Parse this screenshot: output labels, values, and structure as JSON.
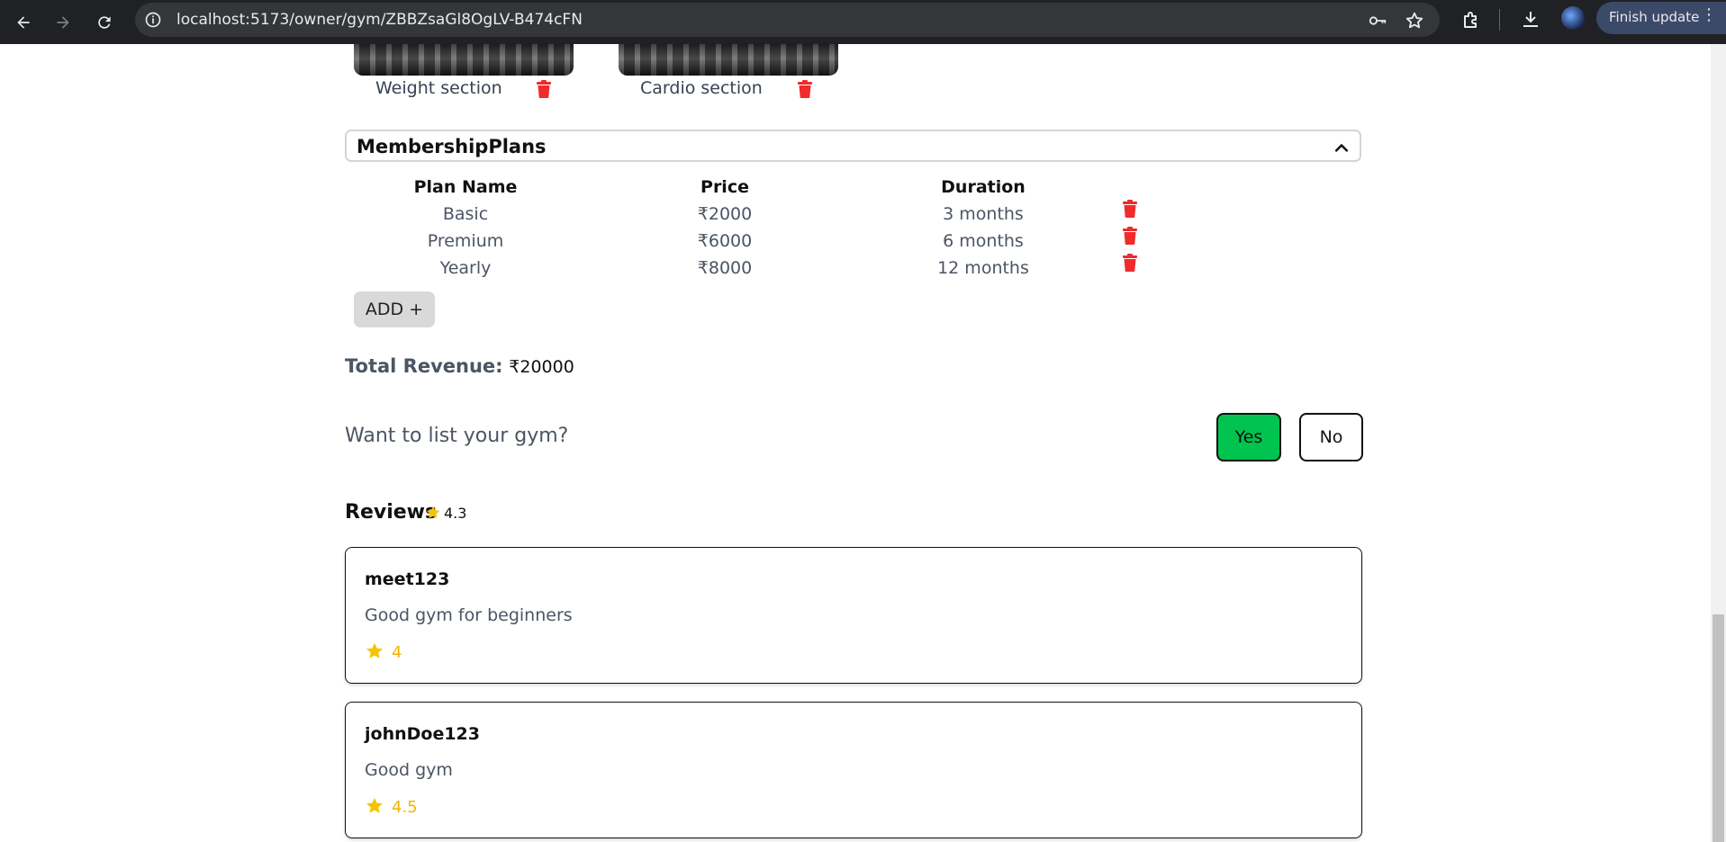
{
  "browser": {
    "url": "localhost:5173/owner/gym/ZBBZsaGl8OgLV-B474cFN",
    "finish_update_label": "Finish update"
  },
  "images": [
    {
      "caption": "Weight section"
    },
    {
      "caption": "Cardio section"
    }
  ],
  "membership": {
    "title": "MembershipPlans",
    "headers": {
      "plan": "Plan Name",
      "price": "Price",
      "duration": "Duration"
    },
    "plans": [
      {
        "name": "Basic",
        "price": "₹2000",
        "duration": "3 months"
      },
      {
        "name": "Premium",
        "price": "₹6000",
        "duration": "6 months"
      },
      {
        "name": "Yearly",
        "price": "₹8000",
        "duration": "12 months"
      }
    ],
    "add_label": "ADD +"
  },
  "revenue": {
    "label": "Total Revenue:",
    "value": "₹20000"
  },
  "listing": {
    "question": "Want to list your gym?",
    "yes_label": "Yes",
    "no_label": "No"
  },
  "reviews": {
    "title": "Reviews",
    "average": "4.3",
    "items": [
      {
        "user": "meet123",
        "text": "Good gym for beginners",
        "rating": "4"
      },
      {
        "user": "johnDoe123",
        "text": "Good gym",
        "rating": "4.5"
      }
    ]
  },
  "colors": {
    "accent_green": "#00c44f",
    "trash_red": "#ef2b2b",
    "star_yellow": "#f5b400"
  }
}
